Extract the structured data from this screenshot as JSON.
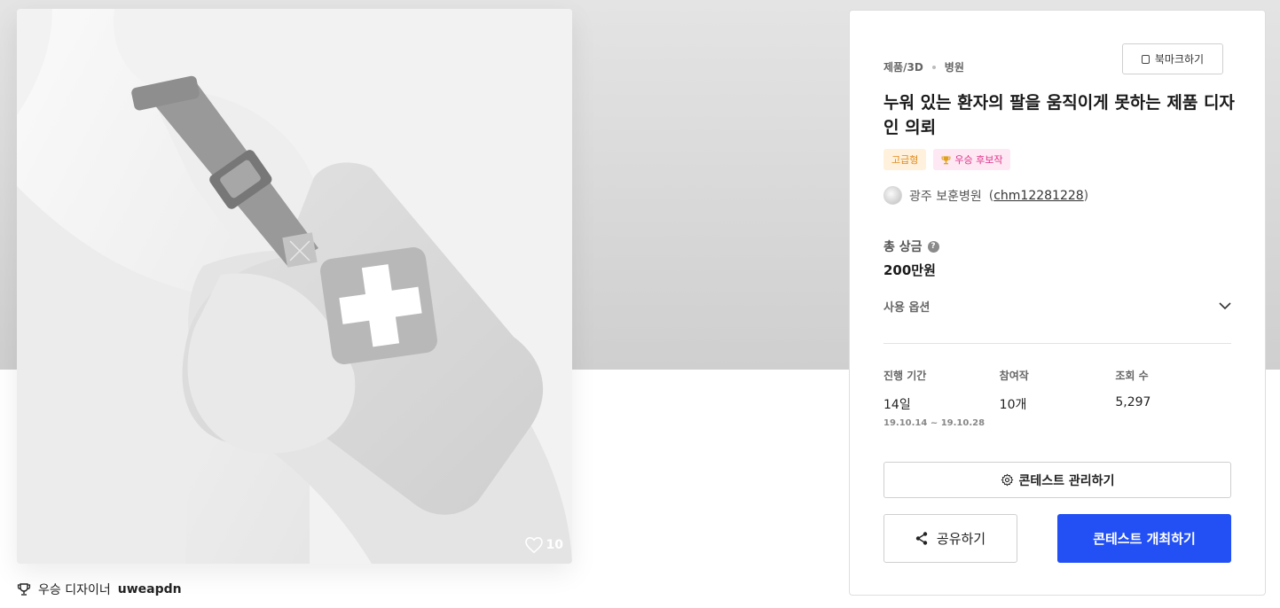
{
  "image": {
    "alt_icon": "arm-sling-render",
    "likes": "10"
  },
  "winner": {
    "label": "우승 디자이너",
    "name": "uweapdn"
  },
  "panel": {
    "bookmark_label": "북마크하기",
    "breadcrumb": [
      "제품/3D",
      "병원"
    ],
    "title": "누워 있는 환자의 팔을 움직이게 못하는 제품 디자인 의뢰",
    "badges": {
      "premium": "고급형",
      "award": "우승 후보작"
    },
    "host": {
      "name": "광주 보훈병원",
      "id_prefix": "(",
      "id": "chm12281228",
      "id_suffix": ")"
    },
    "prize": {
      "label": "총 상금",
      "value": "200만원"
    },
    "use_option_label": "사용 옵션",
    "stats": {
      "period_label": "진행 기간",
      "period_value": "14일",
      "period_range": "19.10.14 ~ 19.10.28",
      "entries_label": "참여작",
      "entries_value": "10개",
      "views_label": "조회 수",
      "views_value": "5,297"
    },
    "manage_label": "콘테스트 관리하기",
    "share_label": "공유하기",
    "host_contest_label": "콘테스트 개최하기"
  },
  "colors": {
    "primary": "#2250f4",
    "premium_badge_bg": "#fff1dc",
    "award_badge_bg": "#fde8f3"
  }
}
